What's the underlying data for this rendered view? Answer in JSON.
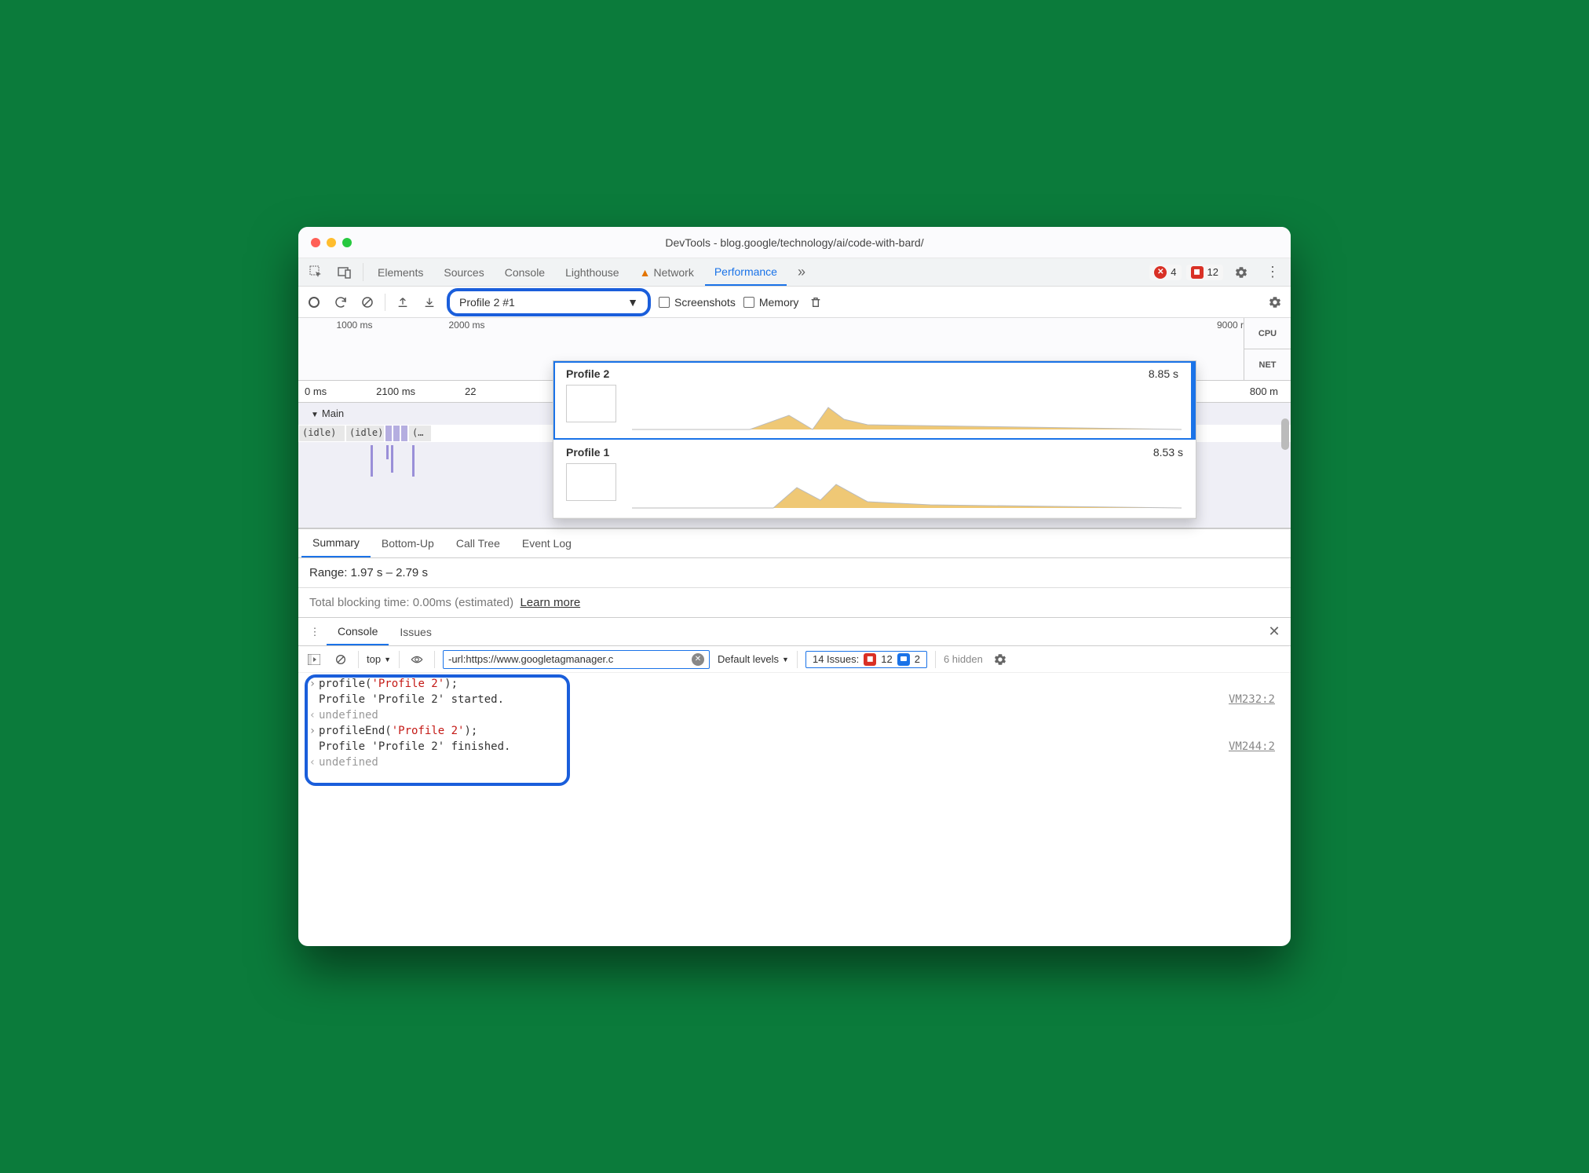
{
  "window": {
    "title": "DevTools - blog.google/technology/ai/code-with-bard/"
  },
  "tabs": {
    "elements": "Elements",
    "sources": "Sources",
    "console": "Console",
    "lighthouse": "Lighthouse",
    "network": "Network",
    "performance": "Performance"
  },
  "badges": {
    "errors_count": "4",
    "issues_count": "12"
  },
  "perf_toolbar": {
    "selected_profile": "Profile 2 #1",
    "screenshots_label": "Screenshots",
    "memory_label": "Memory"
  },
  "overview": {
    "ticks": [
      "1000 ms",
      "2000 ms"
    ],
    "right_tick": "9000 r",
    "cpu_label": "CPU",
    "net_label": "NET"
  },
  "dropdown": {
    "items": [
      {
        "name": "Profile 2",
        "duration": "8.85 s"
      },
      {
        "name": "Profile 1",
        "duration": "8.53 s"
      }
    ]
  },
  "ruler": {
    "ticks": [
      "0 ms",
      "2100 ms",
      "22"
    ],
    "right": "800 m"
  },
  "flame": {
    "main_label": "Main",
    "idle1": "(idle)",
    "idle2": "(idle)",
    "trunc": "(…"
  },
  "subtabs": {
    "summary": "Summary",
    "bottomup": "Bottom-Up",
    "calltree": "Call Tree",
    "eventlog": "Event Log"
  },
  "range_text": "Range: 1.97 s – 2.79 s",
  "tbt": {
    "text": "Total blocking time: 0.00ms (estimated)",
    "learn_more": "Learn more"
  },
  "drawer": {
    "console": "Console",
    "issues": "Issues"
  },
  "console_bar": {
    "context": "top",
    "filter_value": "-url:https://www.googletagmanager.c",
    "levels": "Default levels",
    "issues_label": "14 Issues:",
    "issues_n1": "12",
    "issues_n2": "2",
    "hidden": "6 hidden"
  },
  "console_lines": {
    "l1_pre": "profile(",
    "l1_arg": "'Profile 2'",
    "l1_post": ");",
    "l2": "Profile 'Profile 2' started.",
    "l2_tag": "VM232:2",
    "l3": "undefined",
    "l4_pre": "profileEnd(",
    "l4_arg": "'Profile 2'",
    "l4_post": ");",
    "l5": "Profile 'Profile 2' finished.",
    "l5_tag": "VM244:2",
    "l6": "undefined"
  }
}
